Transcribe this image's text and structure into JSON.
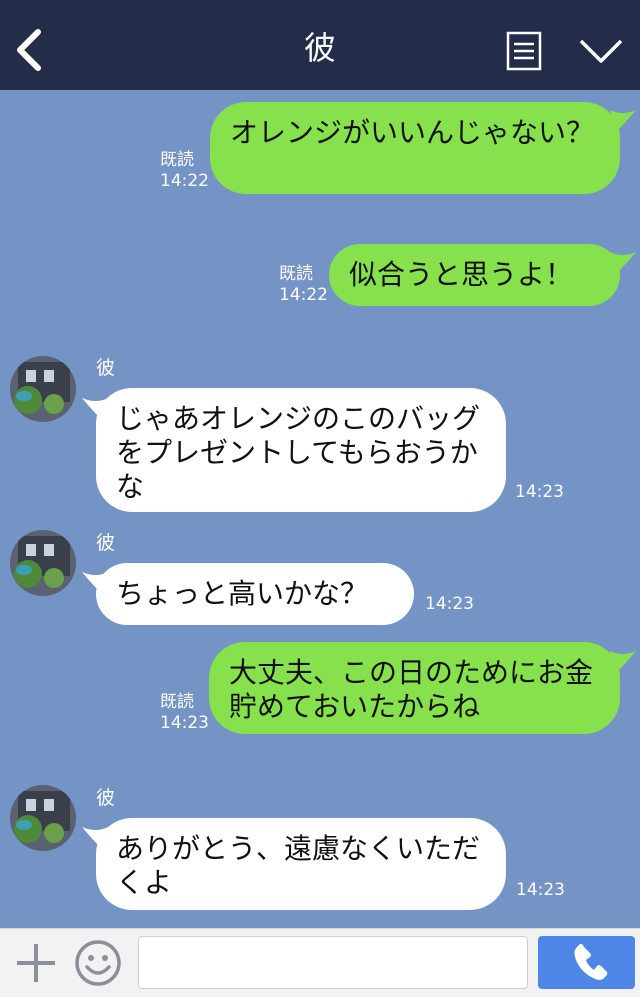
{
  "header": {
    "title": "彼"
  },
  "messages": [
    {
      "side": "sent",
      "text": "オレンジがいいんじゃない？",
      "read": "既読",
      "time": "14:22"
    },
    {
      "side": "sent",
      "text": "似合うと思うよ！",
      "read": "既読",
      "time": "14:22"
    },
    {
      "side": "recv",
      "sender": "彼",
      "text": "じゃあオレンジのこのバッグをプレゼントしてもらおうかな",
      "time": "14:23"
    },
    {
      "side": "recv",
      "sender": "彼",
      "text": "ちょっと高いかな？",
      "time": "14:23"
    },
    {
      "side": "sent",
      "text": "大丈夫、この日のためにお金貯めておいたからね",
      "read": "既読",
      "time": "14:23"
    },
    {
      "side": "recv",
      "sender": "彼",
      "text": "ありがとう、遠慮なくいただくよ",
      "time": "14:23"
    }
  ],
  "input": {
    "placeholder": "",
    "value": ""
  },
  "colors": {
    "header_bg": "#232c48",
    "chat_bg": "#7494c6",
    "sent_bubble": "#86e14d",
    "recv_bubble": "#ffffff",
    "call_button": "#4d86e6"
  },
  "icons": {
    "back": "back-chevron-icon",
    "menu": "notes-icon",
    "collapse": "chevron-down-icon",
    "plus": "plus-icon",
    "emoji": "smiley-icon",
    "call": "phone-icon"
  }
}
